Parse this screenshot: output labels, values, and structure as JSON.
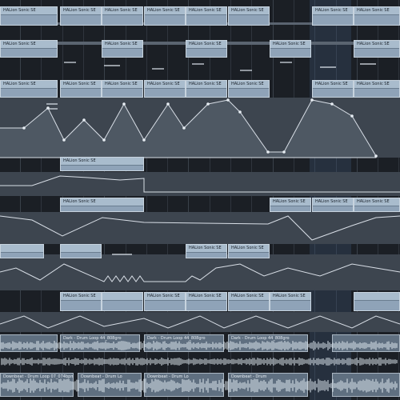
{
  "window": {
    "app": "DAW arrangement"
  },
  "clip_name_synth": "HALion Sonic SE",
  "clip_name_drum_dark": "Dark - Drum Loop 44_808gro",
  "clip_name_drum_down": "Downbeat - Drum Loop 07_074bpm",
  "clip_name_drum_down_short": "Downbeat - Drum Lo",
  "clip_name_drum_down_shorter": "Downbeat - Drum",
  "colors": {
    "grid": "#2f353d",
    "clip": "#8fa3b8",
    "lane": "#4a5360",
    "highlight": "#5a82b4"
  }
}
